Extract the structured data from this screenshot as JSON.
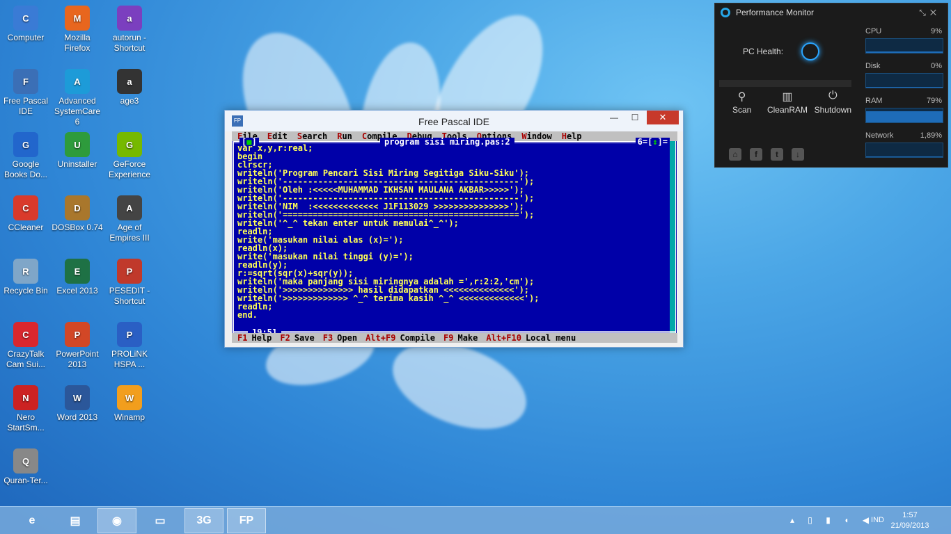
{
  "desktop_icons": [
    {
      "label": "Computer",
      "color": "#3a7bd5"
    },
    {
      "label": "Mozilla Firefox",
      "color": "#e8661e"
    },
    {
      "label": "autorun - Shortcut",
      "color": "#7b3fbf"
    },
    {
      "label": "Free Pascal IDE",
      "color": "#3b6fb6"
    },
    {
      "label": "Advanced SystemCare 6",
      "color": "#1d9bd8"
    },
    {
      "label": "age3",
      "color": "#333333"
    },
    {
      "label": "Google Books Do...",
      "color": "#2266cc"
    },
    {
      "label": "Uninstaller",
      "color": "#2e9b3c"
    },
    {
      "label": "GeForce Experience",
      "color": "#76b900"
    },
    {
      "label": "CCleaner",
      "color": "#d93a2b"
    },
    {
      "label": "DOSBox 0.74",
      "color": "#a9772c"
    },
    {
      "label": "Age of Empires III",
      "color": "#444444"
    },
    {
      "label": "Recycle Bin",
      "color": "#7fa6c8"
    },
    {
      "label": "Excel 2013",
      "color": "#1e7145"
    },
    {
      "label": "PESEDIT - Shortcut",
      "color": "#c0392b"
    },
    {
      "label": "CrazyTalk Cam Sui...",
      "color": "#d9272e"
    },
    {
      "label": "PowerPoint 2013",
      "color": "#d24726"
    },
    {
      "label": "PROLiNK HSPA ...",
      "color": "#2a5fc4"
    },
    {
      "label": "Nero StartSm...",
      "color": "#cc2222"
    },
    {
      "label": "Word 2013",
      "color": "#2b579a"
    },
    {
      "label": "Winamp",
      "color": "#f29e1d"
    },
    {
      "label": "Quran-Ter...",
      "color": "#888888"
    }
  ],
  "window": {
    "title": "Free Pascal IDE",
    "min": "—",
    "max": "☐",
    "close": "✕"
  },
  "ide": {
    "menu": [
      {
        "hot": "F",
        "rest": "ile"
      },
      {
        "hot": "E",
        "rest": "dit"
      },
      {
        "hot": "S",
        "rest": "earch"
      },
      {
        "hot": "R",
        "rest": "un"
      },
      {
        "hot": "C",
        "rest": "ompile"
      },
      {
        "hot": "D",
        "rest": "ebug"
      },
      {
        "hot": "T",
        "rest": "ools"
      },
      {
        "hot": "O",
        "rest": "ptions"
      },
      {
        "hot": "W",
        "rest": "indow"
      },
      {
        "hot": "H",
        "rest": "elp"
      }
    ],
    "close_box_left": "[",
    "close_box_mark": "■",
    "close_box_right": "]",
    "filename": "program sisi miring.pas:2",
    "window_number": "6=[",
    "window_number_mark": "↕",
    "window_number_end": "]=",
    "cursor_pos": "19:51",
    "code_lines": [
      "var x,y,r:real;",
      "begin",
      "clrscr;",
      "writeln('Program Pencari Sisi Miring Segitiga Siku-Siku');",
      "writeln('-----------------------------------------------');",
      "writeln('Oleh :<<<<<MUHAMMAD IKHSAN MAULANA AKBAR>>>>>');",
      "writeln('-----------------------------------------------');",
      "writeln('NIM  :<<<<<<<<<<<<< J1F113029 >>>>>>>>>>>>>>>');",
      "writeln('===============================================');",
      "writeln('^_^ tekan enter untuk memulai^_^');",
      "readln;",
      "write('masukan nilai alas (x)=');",
      "readln(x);",
      "write('masukan nilai tinggi (y)=');",
      "readln(y);",
      "r:=sqrt(sqr(x)+sqr(y));",
      "writeln('maka panjang sisi miringnya adalah =',r:2:2,'cm');",
      "writeln('>>>>>>>>>>>>>> hasil didapatkan <<<<<<<<<<<<<<');",
      "writeln('>>>>>>>>>>>>> ^_^ terima kasih ^_^ <<<<<<<<<<<<<');",
      "readln;",
      "end."
    ],
    "status": [
      {
        "key": "F1",
        "label": "Help"
      },
      {
        "key": "F2",
        "label": "Save"
      },
      {
        "key": "F3",
        "label": "Open"
      },
      {
        "key": "Alt+F9",
        "label": "Compile"
      },
      {
        "key": "F9",
        "label": "Make"
      },
      {
        "key": "Alt+F10",
        "label": "Local menu"
      }
    ]
  },
  "perf": {
    "title": "Performance Monitor",
    "health_label": "PC Health:",
    "actions": [
      {
        "icon": "search-icon",
        "glyph": "⚲",
        "label": "Scan"
      },
      {
        "icon": "ram-icon",
        "glyph": "▥",
        "label": "CleanRAM"
      },
      {
        "icon": "power-icon",
        "glyph": "⏻",
        "label": "Shutdown"
      }
    ],
    "metrics": [
      {
        "label": "CPU",
        "value": "9%",
        "level": 0.09
      },
      {
        "label": "Disk",
        "value": "0%",
        "level": 0.0
      },
      {
        "label": "RAM",
        "value": "79%",
        "level": 0.79
      },
      {
        "label": "Network",
        "value": "1,89%",
        "level": 0.02
      }
    ]
  },
  "taskbar": {
    "items": [
      {
        "icon": "internet-explorer-icon",
        "glyph": "e"
      },
      {
        "icon": "file-explorer-icon",
        "glyph": "▤"
      },
      {
        "icon": "firefox-icon",
        "glyph": "◉"
      },
      {
        "icon": "window-app-icon",
        "glyph": "▭"
      },
      {
        "icon": "prolink-3g-icon",
        "glyph": "3G"
      },
      {
        "icon": "free-pascal-icon",
        "glyph": "FP"
      }
    ],
    "lang": "IND",
    "time": "1:57",
    "date": "21/09/2013"
  }
}
